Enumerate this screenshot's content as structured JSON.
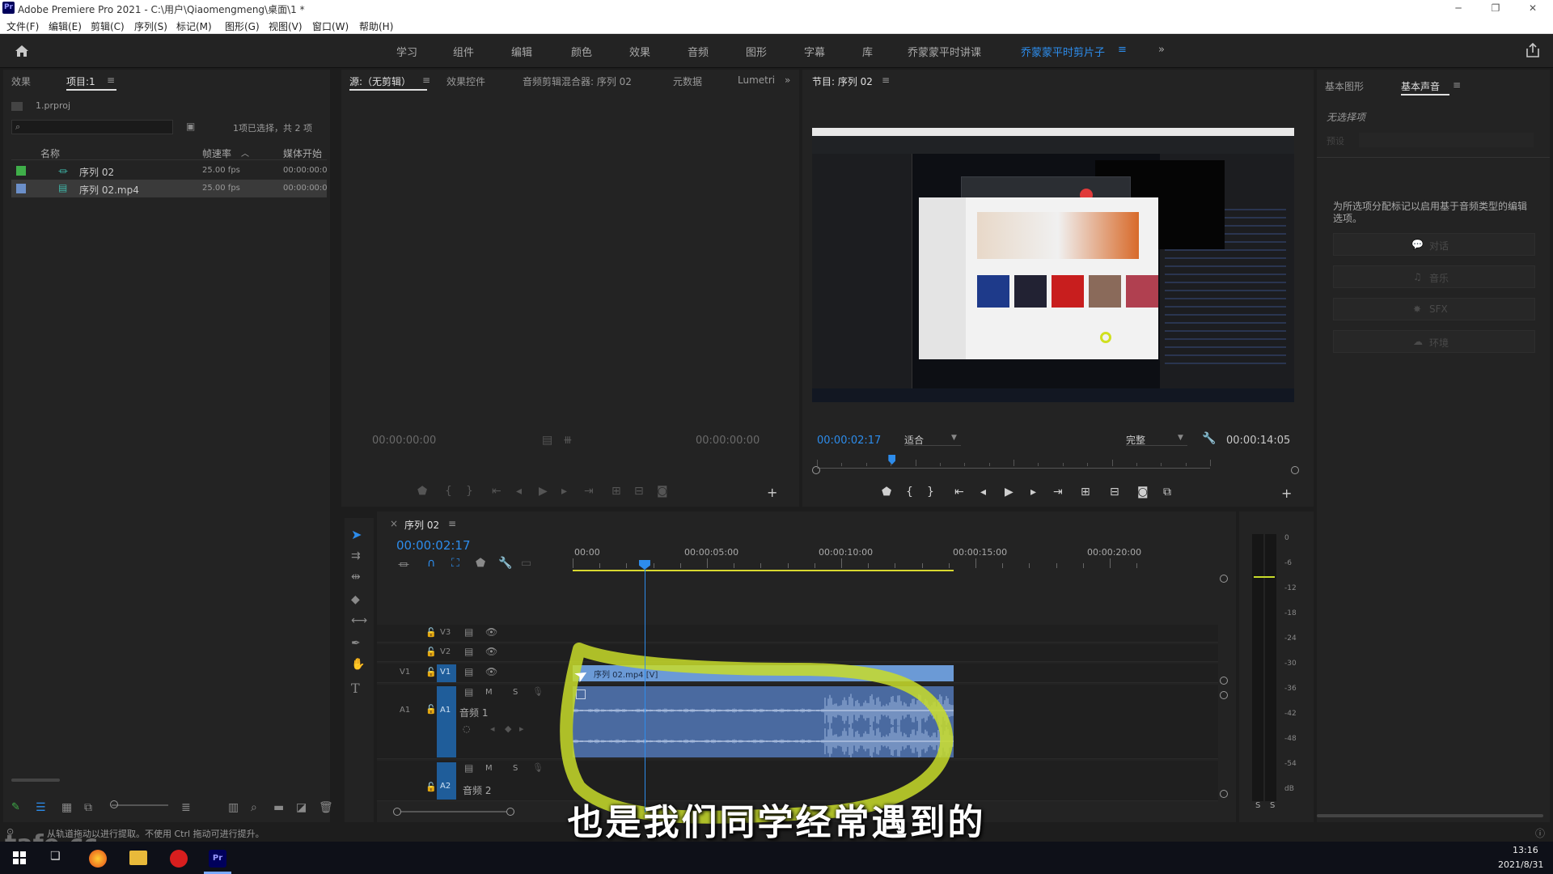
{
  "window": {
    "title": "Adobe Premiere Pro 2021 - C:\\用户\\Qiaomengmeng\\桌面\\1 *",
    "app_icon": "Pr"
  },
  "menu": [
    "文件(F)",
    "编辑(E)",
    "剪辑(C)",
    "序列(S)",
    "标记(M)",
    "图形(G)",
    "视图(V)",
    "窗口(W)",
    "帮助(H)"
  ],
  "workspaces": [
    "学习",
    "组件",
    "编辑",
    "颜色",
    "效果",
    "音频",
    "图形",
    "字幕",
    "库",
    "乔蒙蒙平时讲课",
    "乔蒙蒙平时剪片子"
  ],
  "active_workspace": "乔蒙蒙平时剪片子",
  "project": {
    "tabs": [
      "效果",
      "项目:1"
    ],
    "file": "1.prproj",
    "selection_info": "1项已选择，共 2 项",
    "columns": [
      "名称",
      "帧速率",
      "媒体开始"
    ],
    "items": [
      {
        "name": "序列 02",
        "fps": "25.00 fps",
        "start": "00:00:00:00",
        "color": "#3fae49"
      },
      {
        "name": "序列 02.mp4",
        "fps": "25.00 fps",
        "start": "00:00:00:00",
        "color": "#6b8fc9"
      }
    ]
  },
  "source": {
    "tabs": [
      "源:（无剪辑）",
      "效果控件",
      "音频剪辑混合器: 序列 02",
      "元数据",
      "Lumetri"
    ],
    "tc_left": "00:00:00:00",
    "tc_right": "00:00:00:00"
  },
  "program": {
    "tab": "节目: 序列 02",
    "timecode": "00:00:02:17",
    "fit": "适合",
    "quality": "完整",
    "duration": "00:00:14:05",
    "playhead_fraction": 0.19
  },
  "essential": {
    "tabs": [
      "基本图形",
      "基本声音"
    ],
    "no_selection": "无选择项",
    "preset_label": "预设",
    "hint": "为所选项分配标记以启用基于音频类型的编辑选项。",
    "buttons": [
      "对话",
      "音乐",
      "SFX",
      "环境"
    ]
  },
  "timeline": {
    "tab": "序列 02",
    "timecode": "00:00:02:17",
    "ruler": [
      "00:00",
      "00:00:05:00",
      "00:00:10:00",
      "00:00:15:00",
      "00:00:20:00"
    ],
    "tracks": {
      "v3": "V3",
      "v2": "V2",
      "v1": "V1",
      "a1": "A1",
      "a2": "A2",
      "a1_name": "音频 1",
      "a2_name": "音频 2",
      "m": "M",
      "s": "S"
    },
    "clip_label": "序列 02.mp4 [V]",
    "playhead_seconds": 2.68,
    "clip_end_seconds": 14.2
  },
  "meter": {
    "scale": [
      "0",
      "-6",
      "-12",
      "-18",
      "-24",
      "-30",
      "-36",
      "-42",
      "-48",
      "-54",
      "dB"
    ],
    "solo": [
      "S",
      "S"
    ]
  },
  "status": "从轨道拖动以进行提取。不使用 Ctrl 拖动可进行提升。",
  "subtitle": "也是我们同学经常遇到的",
  "watermark": "tafe.cc",
  "taskbar": {
    "time": "13:16",
    "date": "2021/8/31"
  },
  "colors": {
    "accent": "#2d8ceb",
    "clip_video": "#6b9ad6",
    "clip_audio": "#4a6aa0",
    "highlight": "#c8dc2a"
  }
}
